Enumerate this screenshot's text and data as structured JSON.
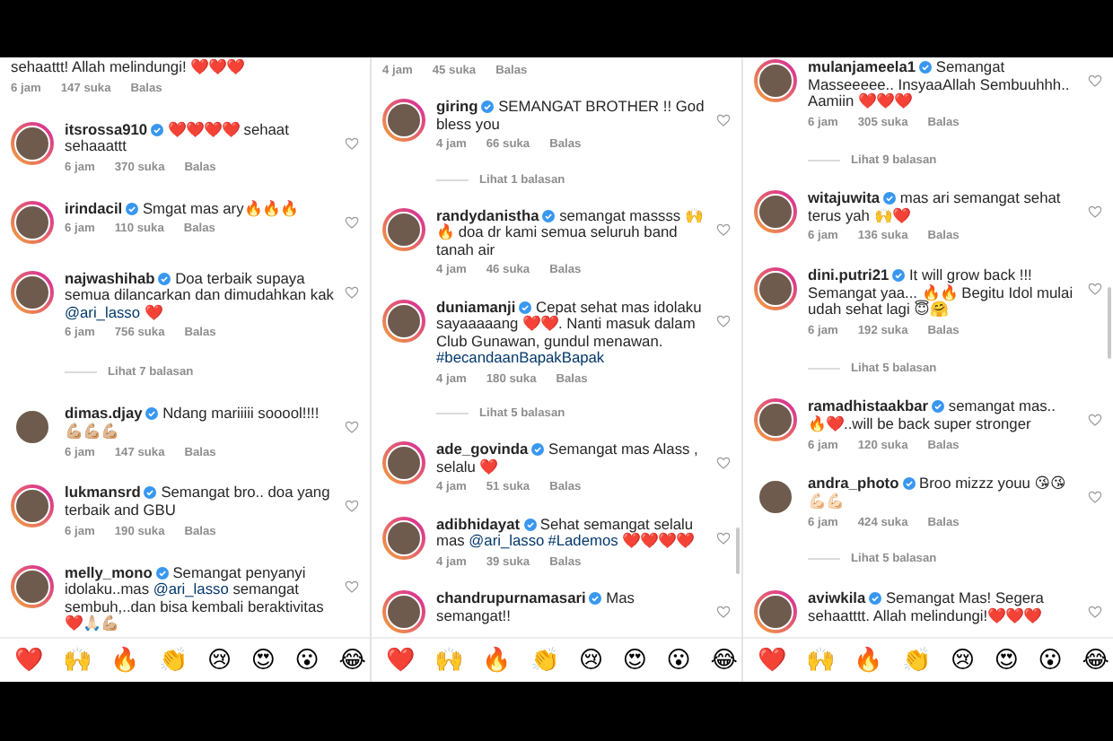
{
  "panels": [
    {
      "items": [
        {
          "kind": "fragment",
          "parts": [
            {
              "text": "sehaattt! Allah melindungi! ❤️❤️❤️"
            }
          ],
          "time": "6 jam",
          "likes": "147 suka",
          "reply": "Balas"
        },
        {
          "kind": "comment",
          "username": "itsrossa910",
          "verified": true,
          "story_ring": true,
          "parts": [
            {
              "text": "❤️❤️❤️❤️ sehaat sehaaattt"
            }
          ],
          "time": "6 jam",
          "likes": "370 suka",
          "reply": "Balas"
        },
        {
          "kind": "comment",
          "username": "irindacil",
          "verified": true,
          "story_ring": true,
          "parts": [
            {
              "text": "Smgat mas ary🔥🔥🔥"
            }
          ],
          "time": "6 jam",
          "likes": "110 suka",
          "reply": "Balas"
        },
        {
          "kind": "comment",
          "username": "najwashihab",
          "verified": true,
          "story_ring": true,
          "parts": [
            {
              "text": "Doa terbaik supaya semua dilancarkan dan dimudahkan kak "
            },
            {
              "text": "@ari_lasso",
              "link": true
            },
            {
              "text": " ❤️"
            }
          ],
          "time": "6 jam",
          "likes": "756 suka",
          "reply": "Balas"
        },
        {
          "kind": "replies",
          "label": "Lihat 7 balasan"
        },
        {
          "kind": "comment",
          "username": "dimas.djay",
          "verified": true,
          "story_ring": false,
          "parts": [
            {
              "text": "Ndang mariiiii sooool!!!! 💪🏼💪🏼💪🏼"
            }
          ],
          "time": "6 jam",
          "likes": "147 suka",
          "reply": "Balas"
        },
        {
          "kind": "comment",
          "username": "lukmansrd",
          "verified": true,
          "story_ring": true,
          "parts": [
            {
              "text": "Semangat bro.. doa yang terbaik and GBU"
            }
          ],
          "time": "6 jam",
          "likes": "190 suka",
          "reply": "Balas"
        },
        {
          "kind": "comment",
          "username": "melly_mono",
          "verified": true,
          "story_ring": true,
          "parts": [
            {
              "text": "Semangat penyanyi idolaku..mas "
            },
            {
              "text": "@ari_lasso",
              "link": true
            },
            {
              "text": " semangat sembuh,..dan bisa kembali beraktivitas ❤️🙏🏻💪🏼"
            }
          ]
        }
      ],
      "emojis": [
        "❤️",
        "🙌",
        "🔥",
        "👏",
        "😢",
        "😍",
        "😮",
        "😂"
      ]
    },
    {
      "items": [
        {
          "kind": "fragment",
          "time": "4 jam",
          "likes": "45 suka",
          "reply": "Balas"
        },
        {
          "kind": "comment",
          "username": "giring",
          "verified": true,
          "story_ring": true,
          "parts": [
            {
              "text": "SEMANGAT BROTHER !! God bless you"
            }
          ],
          "time": "4 jam",
          "likes": "66 suka",
          "reply": "Balas"
        },
        {
          "kind": "replies",
          "label": "Lihat 1 balasan"
        },
        {
          "kind": "comment",
          "username": "randydanistha",
          "verified": true,
          "story_ring": true,
          "parts": [
            {
              "text": "semangat massss 🙌🔥 doa dr kami semua seluruh band tanah air"
            }
          ],
          "time": "4 jam",
          "likes": "46 suka",
          "reply": "Balas"
        },
        {
          "kind": "comment",
          "username": "duniamanji",
          "verified": true,
          "story_ring": true,
          "parts": [
            {
              "text": "Cepat sehat mas idolaku sayaaaaang ❤️❤️. Nanti masuk dalam Club Gunawan, gundul menawan. "
            },
            {
              "text": "#becandaanBapakBapak",
              "link": true
            }
          ],
          "time": "4 jam",
          "likes": "180 suka",
          "reply": "Balas"
        },
        {
          "kind": "replies",
          "label": "Lihat 5 balasan"
        },
        {
          "kind": "comment",
          "username": "ade_govinda",
          "verified": true,
          "story_ring": true,
          "parts": [
            {
              "text": "Semangat mas Alass , selalu ❤️"
            }
          ],
          "time": "4 jam",
          "likes": "51 suka",
          "reply": "Balas"
        },
        {
          "kind": "comment",
          "username": "adibhidayat",
          "verified": true,
          "story_ring": true,
          "parts": [
            {
              "text": "Sehat semangat selalu mas "
            },
            {
              "text": "@ari_lasso",
              "link": true
            },
            {
              "text": "#Lademos",
              "link": true
            },
            {
              "text": " ❤️❤️❤️❤️"
            }
          ],
          "time": "4 jam",
          "likes": "39 suka",
          "reply": "Balas"
        },
        {
          "kind": "comment",
          "username": "chandrupurnamasari",
          "verified": true,
          "story_ring": true,
          "parts": [
            {
              "text": "Mas semangat!!"
            }
          ]
        }
      ],
      "emojis": [
        "❤️",
        "🙌",
        "🔥",
        "👏",
        "😢",
        "😍",
        "😮",
        "😂"
      ]
    },
    {
      "items": [
        {
          "kind": "comment",
          "username": "mulanjameela1",
          "verified": true,
          "story_ring": true,
          "parts": [
            {
              "text": "Semangat Masseeeee.. InsyaaAllah Sembuuhhh.. Aamiin ❤️❤️❤️"
            }
          ],
          "time": "6 jam",
          "likes": "305 suka",
          "reply": "Balas"
        },
        {
          "kind": "replies",
          "label": "Lihat 9 balasan"
        },
        {
          "kind": "comment",
          "username": "witajuwita",
          "verified": true,
          "story_ring": true,
          "parts": [
            {
              "text": "mas ari semangat sehat terus yah 🙌❤️"
            }
          ],
          "time": "6 jam",
          "likes": "136 suka",
          "reply": "Balas"
        },
        {
          "kind": "comment",
          "username": "dini.putri21",
          "verified": true,
          "story_ring": true,
          "parts": [
            {
              "text": "It will grow back !!! Semangat yaa... 🔥🔥 Begitu Idol mulai udah sehat lagi 😇🤗"
            }
          ],
          "time": "6 jam",
          "likes": "192 suka",
          "reply": "Balas"
        },
        {
          "kind": "replies",
          "label": "Lihat 5 balasan"
        },
        {
          "kind": "comment",
          "username": "ramadhistaakbar",
          "verified": true,
          "story_ring": true,
          "parts": [
            {
              "text": "semangat mas.. 🔥❤️..will be back super stronger"
            }
          ],
          "time": "6 jam",
          "likes": "120 suka",
          "reply": "Balas"
        },
        {
          "kind": "comment",
          "username": "andra_photo",
          "verified": true,
          "story_ring": false,
          "parts": [
            {
              "text": "Broo mizzz youu 😘😘 💪🏻💪🏻"
            }
          ],
          "time": "6 jam",
          "likes": "424 suka",
          "reply": "Balas"
        },
        {
          "kind": "replies",
          "label": "Lihat 5 balasan"
        },
        {
          "kind": "comment",
          "username": "aviwkila",
          "verified": true,
          "story_ring": true,
          "parts": [
            {
              "text": "Semangat Mas! Segera sehaatttt. Allah melindungi!❤️❤️❤️"
            }
          ]
        }
      ],
      "emojis": [
        "❤️",
        "🙌",
        "🔥",
        "👏",
        "😢",
        "😍",
        "😮",
        "😂"
      ]
    }
  ]
}
